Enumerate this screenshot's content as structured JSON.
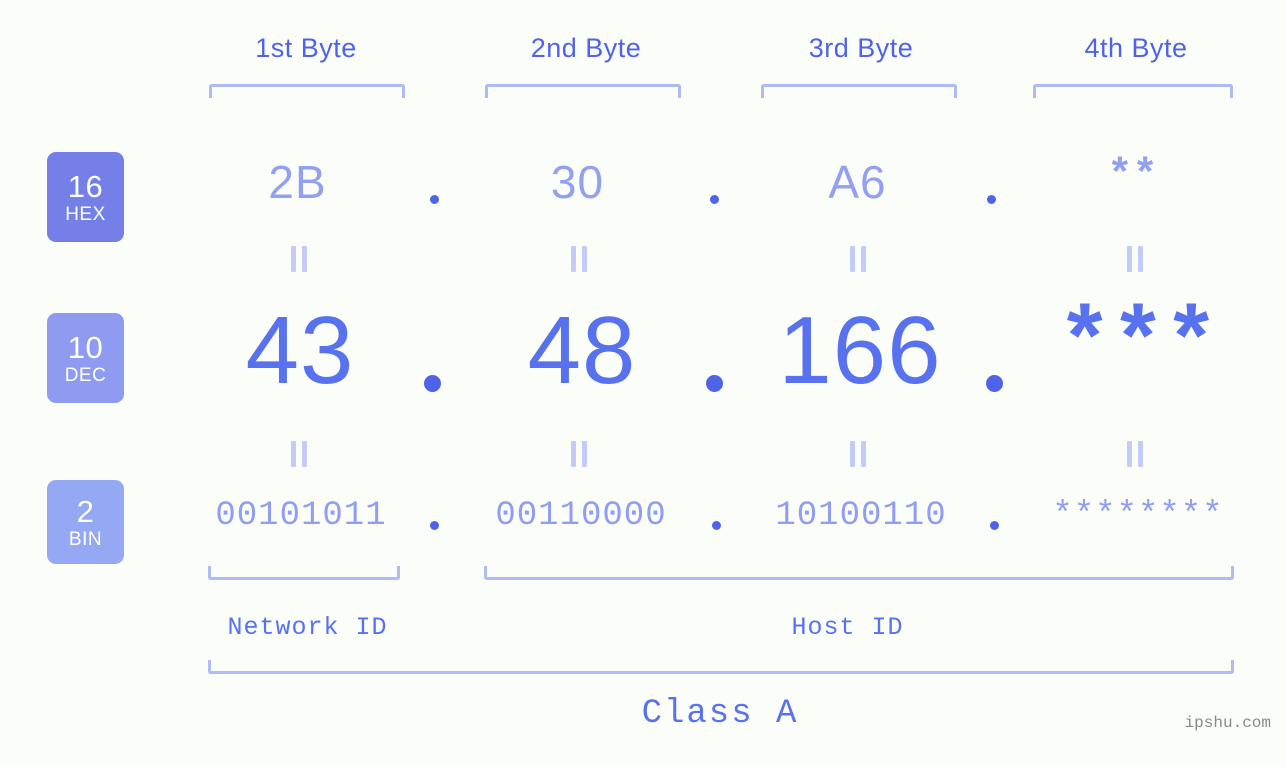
{
  "page": {
    "background": "#fbfdf8",
    "accent": "#4f63e8",
    "accent_light": "#aebbf5",
    "watermark": "ipshu.com"
  },
  "byte_headers": [
    {
      "label": "1st Byte"
    },
    {
      "label": "2nd Byte"
    },
    {
      "label": "3rd Byte"
    },
    {
      "label": "4th Byte"
    }
  ],
  "bases": [
    {
      "num": "16",
      "abbr": "HEX",
      "color": "#7480e8"
    },
    {
      "num": "10",
      "abbr": "DEC",
      "color": "#8e9bf0"
    },
    {
      "num": "2",
      "abbr": "BIN",
      "color": "#94a8f4"
    }
  ],
  "rows": {
    "hex": {
      "values": [
        "2B",
        "30",
        "A6",
        "**"
      ],
      "separator": "."
    },
    "dec": {
      "values": [
        "43",
        "48",
        "166",
        "***"
      ],
      "separator": "."
    },
    "bin": {
      "values": [
        "00101011",
        "00110000",
        "10100110",
        "********"
      ],
      "separator": "."
    }
  },
  "equals_marks": {
    "glyph": "="
  },
  "segments": {
    "network_id": "Network ID",
    "host_id": "Host ID",
    "class": "Class A"
  },
  "chart_data": {
    "type": "table",
    "title": "IP address byte breakdown",
    "categories": [
      "1st Byte",
      "2nd Byte",
      "3rd Byte",
      "4th Byte"
    ],
    "series": [
      {
        "name": "HEX",
        "values": [
          "2B",
          "30",
          "A6",
          "**"
        ]
      },
      {
        "name": "DEC",
        "values": [
          "43",
          "48",
          "166",
          "***"
        ]
      },
      {
        "name": "BIN",
        "values": [
          "00101011",
          "00110000",
          "10100110",
          "********"
        ]
      }
    ],
    "annotations": [
      "Network ID covers 1st Byte",
      "Host ID covers 2nd-4th Bytes",
      "Class A"
    ]
  }
}
